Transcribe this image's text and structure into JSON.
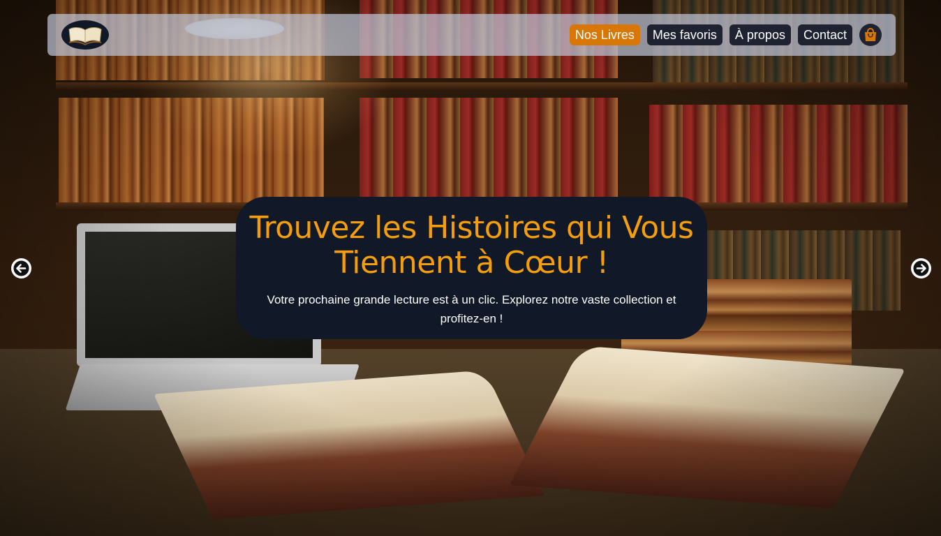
{
  "nav": {
    "logo_icon": "open-book-icon",
    "links": [
      {
        "label": "Nos Livres",
        "active": true
      },
      {
        "label": "Mes favoris",
        "active": false
      },
      {
        "label": "À propos",
        "active": false
      },
      {
        "label": "Contact",
        "active": false
      }
    ],
    "cart_icon": "shopping-bag-icon"
  },
  "hero": {
    "title": "Trouvez les Histoires qui Vous Tiennent à Cœur !",
    "subtitle": "Votre prochaine grande lecture est à un clic. Explorez notre vaste collection et profitez-en !"
  },
  "carousel": {
    "prev_icon": "arrow-left-icon",
    "next_icon": "arrow-right-icon"
  },
  "colors": {
    "accent": "#f59e0b",
    "active_nav": "#d97706",
    "dark": "#111827"
  }
}
